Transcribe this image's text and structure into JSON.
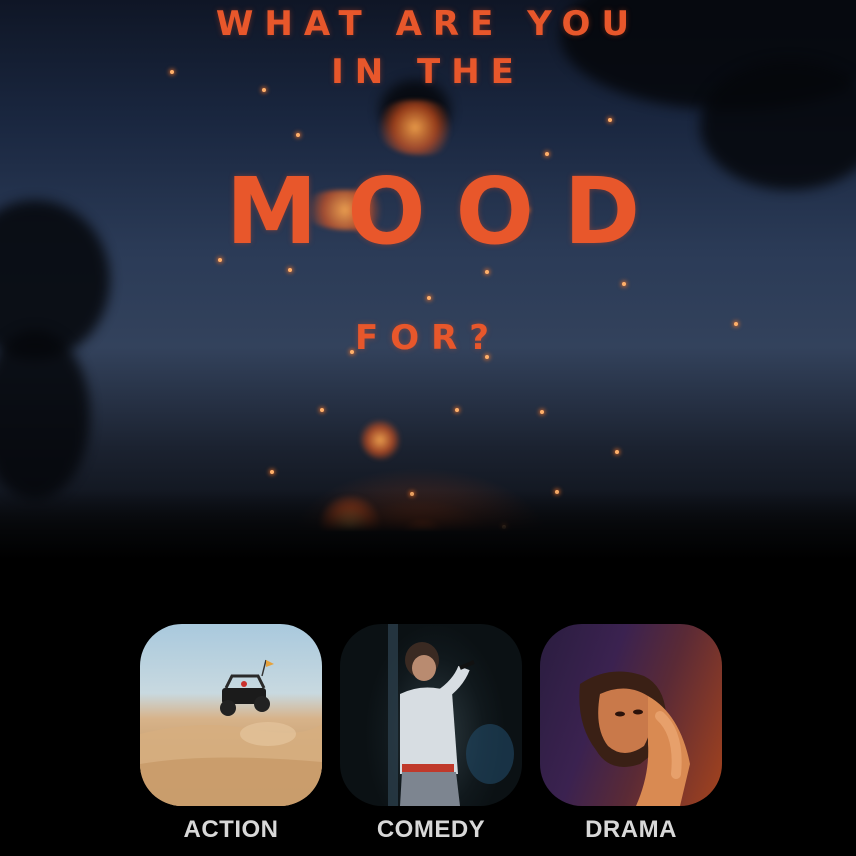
{
  "headline": {
    "line1": "WHAT ARE YOU",
    "line2": "IN THE",
    "line3": "MOOD",
    "line4": "FOR?"
  },
  "moods": [
    {
      "label": "ACTION"
    },
    {
      "label": "COMEDY"
    },
    {
      "label": "DRAMA"
    }
  ],
  "colors": {
    "accent": "#e8572b",
    "label": "#d8d8d8",
    "background": "#000000"
  }
}
